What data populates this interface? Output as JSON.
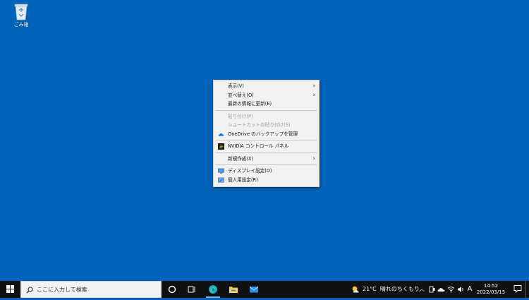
{
  "desktop": {
    "background_color": "#0063b9",
    "icons": [
      {
        "label": "ごみ箱",
        "icon": "recycle-bin-icon"
      }
    ]
  },
  "context_menu": {
    "items": [
      {
        "label": "表示(V)",
        "disabled": false,
        "submenu": true
      },
      {
        "label": "並べ替え(O)",
        "disabled": false,
        "submenu": true
      },
      {
        "label": "最新の情報に更新(E)",
        "disabled": false,
        "submenu": false
      },
      {
        "label": "貼り付け(P)",
        "disabled": true,
        "submenu": false
      },
      {
        "label": "ショートカットの貼り付け(S)",
        "disabled": true,
        "submenu": false
      },
      {
        "label": "OneDrive のバックアップを管理",
        "disabled": false,
        "submenu": false,
        "icon": "onedrive-cloud-icon"
      },
      {
        "label": "NVIDIA コントロール パネル",
        "disabled": false,
        "submenu": false,
        "icon": "nvidia-icon"
      },
      {
        "label": "新規作成(X)",
        "disabled": false,
        "submenu": true
      },
      {
        "label": "ディスプレイ設定(D)",
        "disabled": false,
        "submenu": false,
        "icon": "display-settings-icon"
      },
      {
        "label": "個人用設定(R)",
        "disabled": false,
        "submenu": false,
        "icon": "personalize-icon"
      }
    ],
    "submenu_arrow": "›"
  },
  "taskbar": {
    "search_placeholder": "ここに入力して検索",
    "weather": {
      "temperature": "21°C",
      "condition": "晴れのちくもり"
    },
    "ime": "A",
    "clock": {
      "time": "14:52",
      "date": "2022/03/15"
    },
    "tray_arrow": "︿",
    "accent_color": "#76b9ed"
  }
}
